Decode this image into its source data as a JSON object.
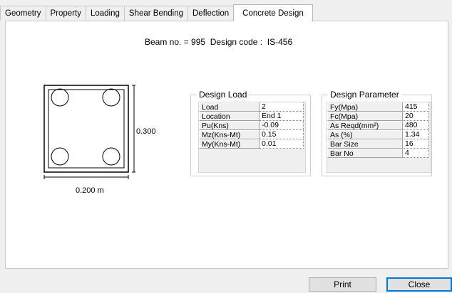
{
  "tabs": [
    "Geometry",
    "Property",
    "Loading",
    "Shear Bending",
    "Deflection",
    "Concrete Design"
  ],
  "active_tab": "Concrete Design",
  "beam_info": "Beam no. = 995  Design code :  IS-456",
  "section": {
    "width_label": "0.200 m",
    "depth_label": "0.300"
  },
  "design_load": {
    "title": "Design Load",
    "rows": [
      {
        "name": "Load",
        "value": "2"
      },
      {
        "name": "Location",
        "value": "End 1"
      },
      {
        "name": "Pu(Kns)",
        "value": "-0.09"
      },
      {
        "name": "Mz(Kns-Mt)",
        "value": "0.15"
      },
      {
        "name": "My(Kns-Mt)",
        "value": "0.01"
      }
    ]
  },
  "design_parameter": {
    "title": "Design Parameter",
    "rows": [
      {
        "name": "Fy(Mpa)",
        "value": "415"
      },
      {
        "name": "Fc(Mpa)",
        "value": "20"
      },
      {
        "name": "As Reqd(mm²)",
        "value": "480"
      },
      {
        "name": "As (%)",
        "value": "1.34"
      },
      {
        "name": "Bar Size",
        "value": "16"
      },
      {
        "name": "Bar No",
        "value": "4"
      }
    ]
  },
  "buttons": {
    "print": "Print",
    "close": "Close"
  }
}
